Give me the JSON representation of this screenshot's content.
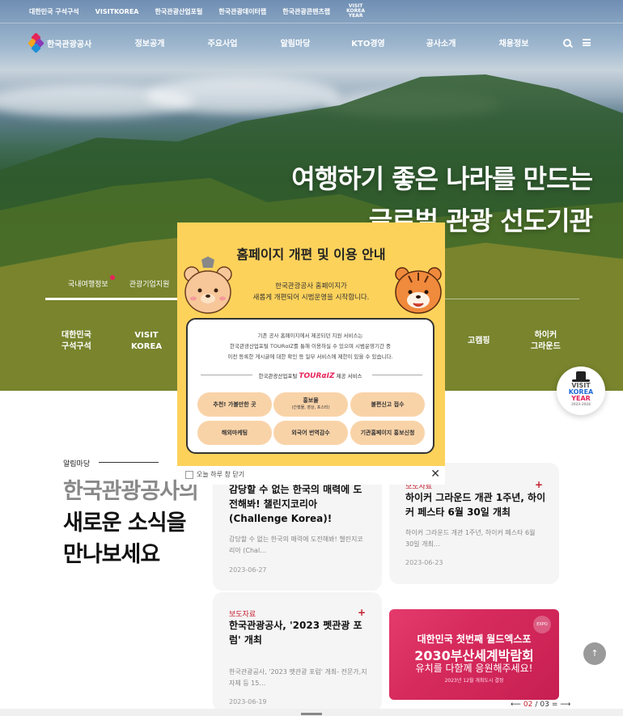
{
  "topbar": {
    "links": [
      "대한민국 구석구석",
      "VISITKOREA",
      "한국관광산업포털",
      "한국관광데이터랩",
      "한국관광콘텐츠랩"
    ],
    "visit_korea_year": [
      "VISIT",
      "KOREA",
      "YEAR"
    ]
  },
  "gnb": {
    "logo_text": "한국관광공사",
    "menu": [
      "정보공개",
      "주요사업",
      "알림마당",
      "KTO경영",
      "공사소개",
      "채용정보"
    ],
    "icons": [
      "search-icon",
      "hamburger-icon"
    ]
  },
  "hero": {
    "title_line1": "여행하기 좋은 나라를 만드는",
    "title_line2": "글로벌 관광 선도기관",
    "tabs": [
      "국내여행정보",
      "관광기업지원"
    ],
    "quick_links": [
      {
        "line1": "대한민국",
        "line2": "구석구석"
      },
      {
        "line1": "VISIT",
        "line2": "KOREA"
      },
      {
        "line1": "고캠핑",
        "line2": ""
      },
      {
        "line1": "하이커",
        "line2": "그라운드"
      }
    ],
    "float_badge": {
      "line1": "VISIT",
      "line2": "KOREA",
      "line3": "YEAR",
      "line4": "2023-2024"
    }
  },
  "popup": {
    "title": "홈페이지 개편 및 이용 안내",
    "subtitle_line1": "한국관광공사 홈페이지가",
    "subtitle_line2": "새롭게 개편되어 시범운영을 시작합니다.",
    "notice_line1": "기존 공사 홈페이지에서 제공되던 지원 서비스는",
    "notice_line2": "한국관광산업포털 TOURαIZ를 통해 이용하실 수 있으며 시범운영기간 중",
    "notice_line3": "이전 등록한 게시글에 대한 확인 등 일부 서비스에 제한이 있을 수 있습니다.",
    "divider_prefix": "한국관광산업포털",
    "divider_brand": "TOURαIZ",
    "divider_suffix": "제공 서비스",
    "pills": [
      {
        "label": "추천! 가볼만한 곳",
        "sub": ""
      },
      {
        "label": "홍보물",
        "sub": "(간행물, 영상, 포스터)"
      },
      {
        "label": "불편신고 접수",
        "sub": ""
      },
      {
        "label": "해외마케팅",
        "sub": ""
      },
      {
        "label": "외국어 번역감수",
        "sub": ""
      },
      {
        "label": "기관홈페이지 홍보신청",
        "sub": ""
      }
    ],
    "dont_show_today": "오늘 하루 창 닫기",
    "close_symbol": "✕"
  },
  "news": {
    "label": "알림마당",
    "heading_line1": "한국관광공사의",
    "heading_line2": "새로운 소식을",
    "heading_line3": "만나보세요",
    "cards": [
      {
        "category": "",
        "title": "감당할 수 없는 한국의 매력에 도전해봐! 챌린지코리아(Challenge Korea)!",
        "desc": "감당할 수 없는 한국의 매력에 도전해봐! 챌린지코리아 (Chal…",
        "date": "2023-06-27"
      },
      {
        "category": "보도자료",
        "title": "하이커 그라운드 개관 1주년, 하이커 페스타 6월 30일 개최",
        "desc": "하이커 그라운드 개관 1주년, 하이커 페스타 6월 30일 개최…",
        "date": "2023-06-23"
      },
      {
        "category": "보도자료",
        "title": "한국관광공사, '2023 펫관광 포럼' 개최",
        "desc": "한국관광공사, '2023 펫관광 포럼' 개최- 전문가,지자체 등 15…",
        "date": "2023-06-19"
      }
    ],
    "plus_symbol": "+",
    "banner": {
      "line1": "대한민국 첫번째 월드엑스포",
      "line2": "2030부산세계박람회",
      "line3": "유치를 다함께 응원해주세요!",
      "line4": "2023년 12월 개최도시 결정",
      "badge": "EXPO"
    },
    "pager": {
      "prev": "⟵",
      "current": "02",
      "sep": "/",
      "total": "03",
      "pause": "=",
      "next": "⟶"
    }
  },
  "top_button": "↑",
  "colors": {
    "accent": "#c4202f",
    "popup_bg": "#fdd25b",
    "pill": "#f9d3a8",
    "banner": "#d62a5c"
  }
}
